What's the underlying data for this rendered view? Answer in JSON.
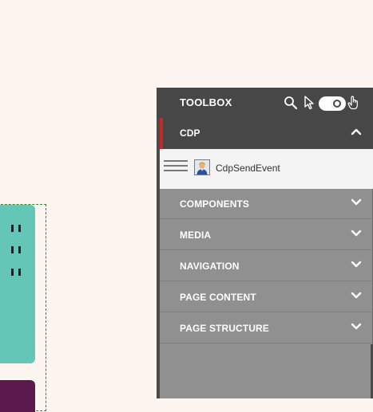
{
  "toolbox": {
    "title": "TOOLBOX",
    "icons": [
      "search-icon",
      "pointer-icon",
      "toggle-switch",
      "hand-icon"
    ]
  },
  "categories": {
    "cdp": {
      "label": "CDP",
      "state": "expanded"
    },
    "list": [
      {
        "label": "COMPONENTS",
        "state": "collapsed"
      },
      {
        "label": "MEDIA",
        "state": "collapsed"
      },
      {
        "label": "NAVIGATION",
        "state": "collapsed"
      },
      {
        "label": "PAGE CONTENT",
        "state": "collapsed"
      },
      {
        "label": "PAGE STRUCTURE",
        "state": "collapsed"
      }
    ]
  },
  "cdp_items": [
    {
      "label": "CdpSendEvent",
      "icon": "user-avatar-icon"
    }
  ],
  "colors": {
    "page_bg": "#fdf6f0",
    "toolbox_header": "#474747",
    "toolbox_body": "#909090",
    "accent": "#c8282c",
    "teal": "#63c6b6",
    "purple": "#5a1a4e"
  }
}
